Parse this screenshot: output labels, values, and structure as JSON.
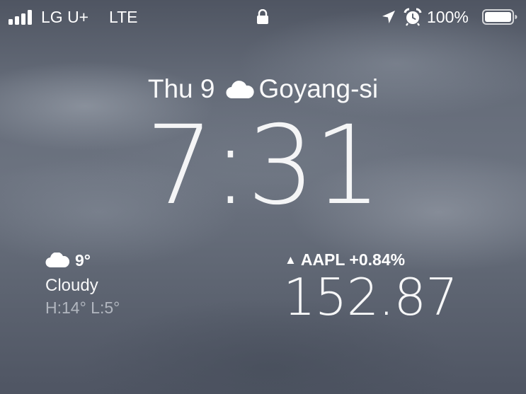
{
  "status_bar": {
    "signal_bars": 4,
    "carrier": "LG U+",
    "network": "LTE",
    "battery_percent": "100%",
    "battery_level": 1.0,
    "icons": [
      "signal-icon",
      "lock-icon",
      "location-icon",
      "alarm-icon",
      "battery-icon"
    ]
  },
  "lock_screen": {
    "date": "Thu 9",
    "weather_icon": "cloud-icon",
    "location": "Goyang-si",
    "time": "7:31"
  },
  "weather_widget": {
    "icon": "cloud-icon",
    "temperature": "9°",
    "condition": "Cloudy",
    "high_low": "H:14° L:5°"
  },
  "stock_widget": {
    "trend_icon": "up-triangle-icon",
    "ticker": "AAPL",
    "change": "+0.84%",
    "price": "152.87"
  }
}
